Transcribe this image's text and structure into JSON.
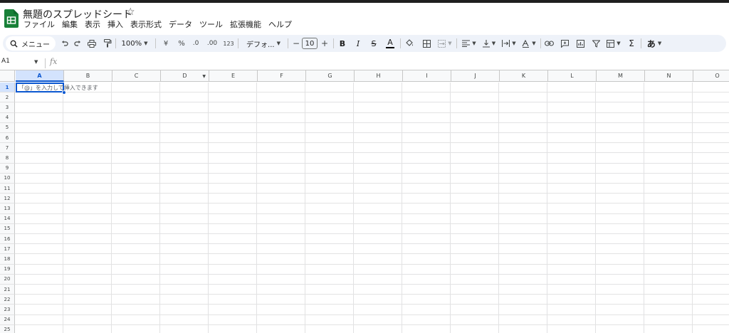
{
  "app": {
    "title": "無題のスプレッドシート",
    "star_glyph": "☆",
    "accent_color": "#0b57d0",
    "logo_color": "#188038"
  },
  "menu": [
    "ファイル",
    "編集",
    "表示",
    "挿入",
    "表示形式",
    "データ",
    "ツール",
    "拡張機能",
    "ヘルプ"
  ],
  "toolbar": {
    "search_label": "メニュー",
    "zoom": "100%",
    "currency": "¥",
    "percent": "%",
    "decrease_decimal": ".0",
    "increase_decimal": ".00",
    "number_format": "123",
    "font_family": "デフォ...",
    "font_size": "10",
    "minus": "−",
    "plus": "+",
    "bold": "B",
    "italic": "I",
    "strike": "S",
    "text_color": "A",
    "sigma": "Σ",
    "input_tools": "あ"
  },
  "formula_bar": {
    "cell_ref": "A1",
    "fx": "fx"
  },
  "grid": {
    "columns": [
      "A",
      "B",
      "C",
      "D",
      "E",
      "F",
      "G",
      "H",
      "I",
      "J",
      "K",
      "L",
      "M",
      "N",
      "O"
    ],
    "rows": [
      "1",
      "2",
      "3",
      "4",
      "5",
      "6",
      "7",
      "8",
      "9",
      "10",
      "11",
      "12",
      "13",
      "14",
      "15",
      "16",
      "17",
      "18",
      "19",
      "20",
      "21",
      "22",
      "23",
      "24",
      "25"
    ],
    "selected_column": "A",
    "selected_row": "1",
    "hint_text": "「@」を入力して挿入できます"
  }
}
